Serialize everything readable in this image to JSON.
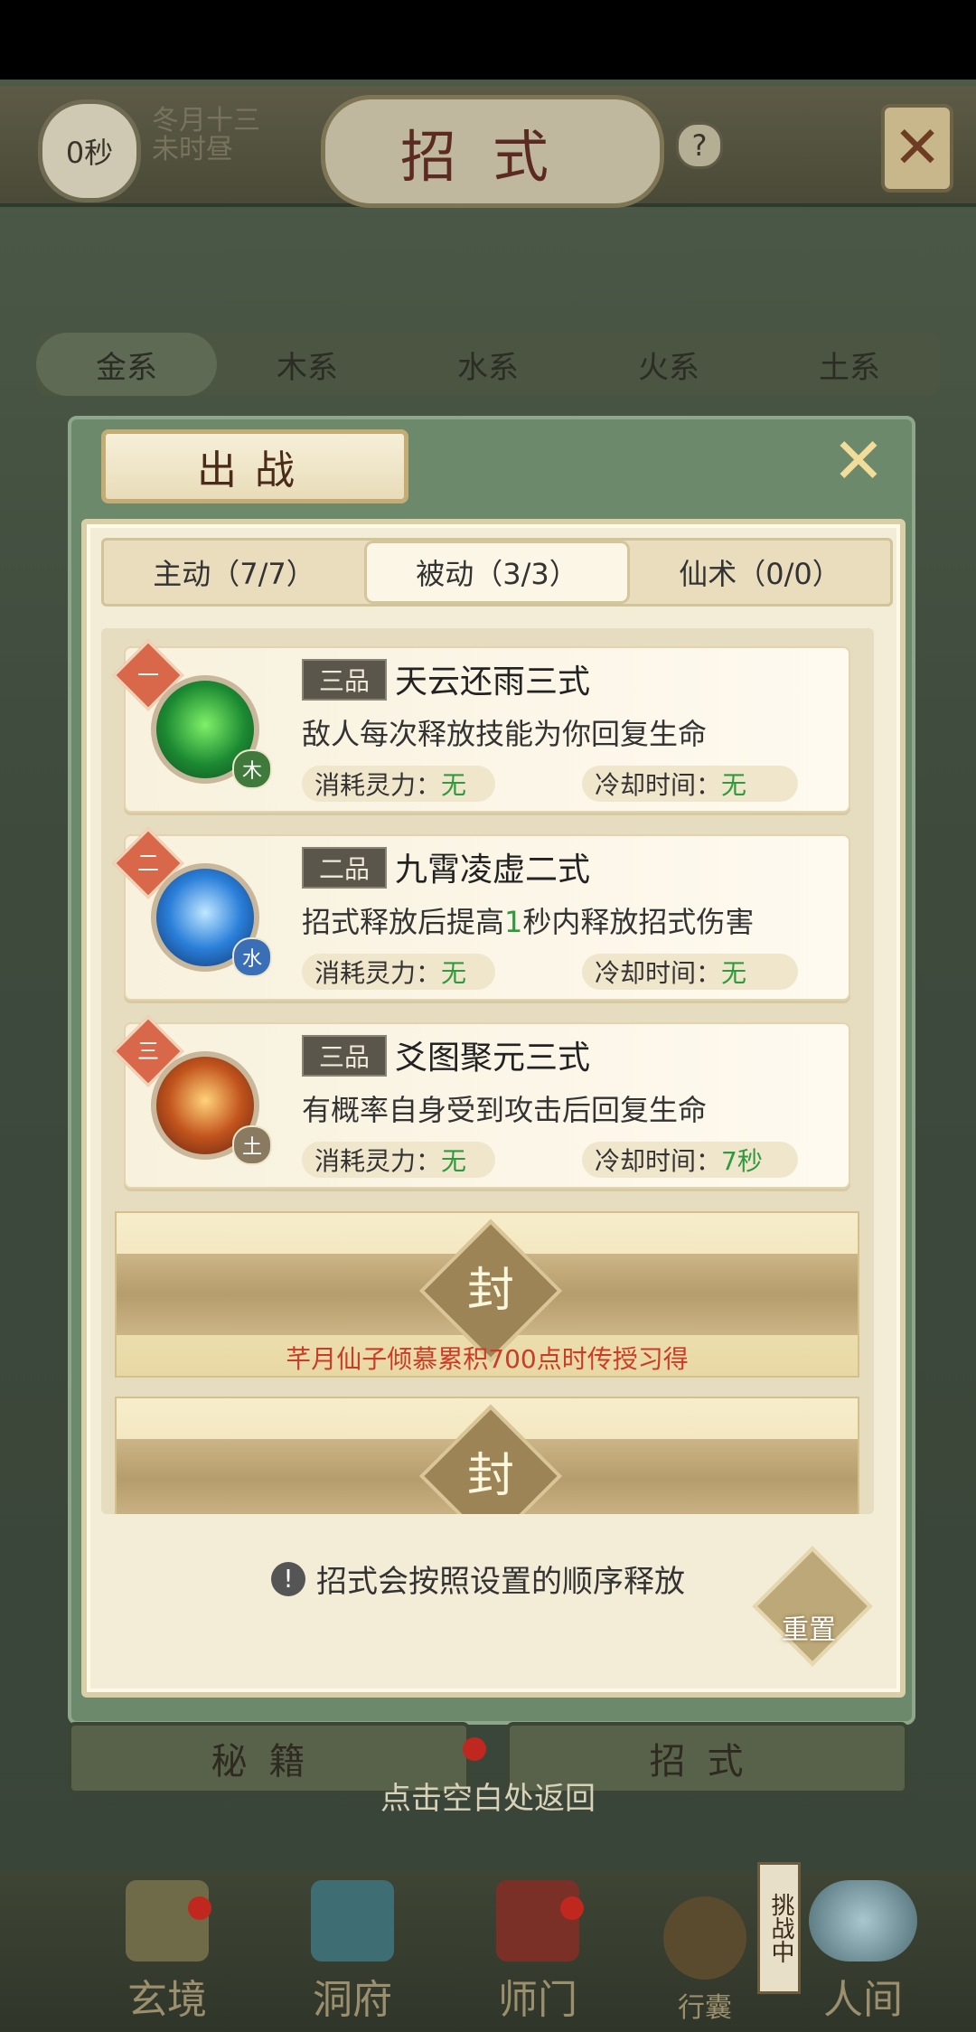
{
  "header": {
    "timer": "0秒",
    "date_line1": "冬月十三",
    "date_line2": "未时昼",
    "title": "招式",
    "help": "?"
  },
  "element_tabs": [
    "金系",
    "木系",
    "水系",
    "火系",
    "土系"
  ],
  "dialog": {
    "title": "出战",
    "tabs": [
      {
        "label": "主动（7/7）",
        "active": false
      },
      {
        "label": "被动（3/3）",
        "active": true
      },
      {
        "label": "仙术（0/0）",
        "active": false
      }
    ],
    "skills": [
      {
        "order": "一",
        "element": "木",
        "grade": "三品",
        "name": "天云还雨三式",
        "description": "敌人每次释放技能为你回复生命",
        "cost_label": "消耗灵力：",
        "cost_value": "无",
        "cooldown_label": "冷却时间：",
        "cooldown_value": "无"
      },
      {
        "order": "二",
        "element": "水",
        "grade": "二品",
        "name": "九霄凌虚二式",
        "description_pre": "招式释放后提高",
        "description_num": "1",
        "description_post": "秒内释放招式伤害",
        "cost_label": "消耗灵力：",
        "cost_value": "无",
        "cooldown_label": "冷却时间：",
        "cooldown_value": "无"
      },
      {
        "order": "三",
        "element": "土",
        "grade": "三品",
        "name": "爻图聚元三式",
        "description": "有概率自身受到攻击后回复生命",
        "cost_label": "消耗灵力：",
        "cost_value": "无",
        "cooldown_label": "冷却时间：",
        "cooldown_value": "7秒"
      }
    ],
    "locked_slots": [
      {
        "seal": "封",
        "unlock_text": "芊月仙子倾慕累积700点时传授习得"
      },
      {
        "seal": "封",
        "unlock_text": ""
      }
    ],
    "order_hint": "招式会按照设置的顺序释放",
    "reset_label": "重置"
  },
  "bottom_tabs": [
    "秘籍",
    "招式"
  ],
  "return_hint": "点击空白处返回",
  "bottom_nav": [
    "玄境",
    "洞府",
    "师门",
    "行囊",
    "人间"
  ],
  "side_badge": "挑战中"
}
